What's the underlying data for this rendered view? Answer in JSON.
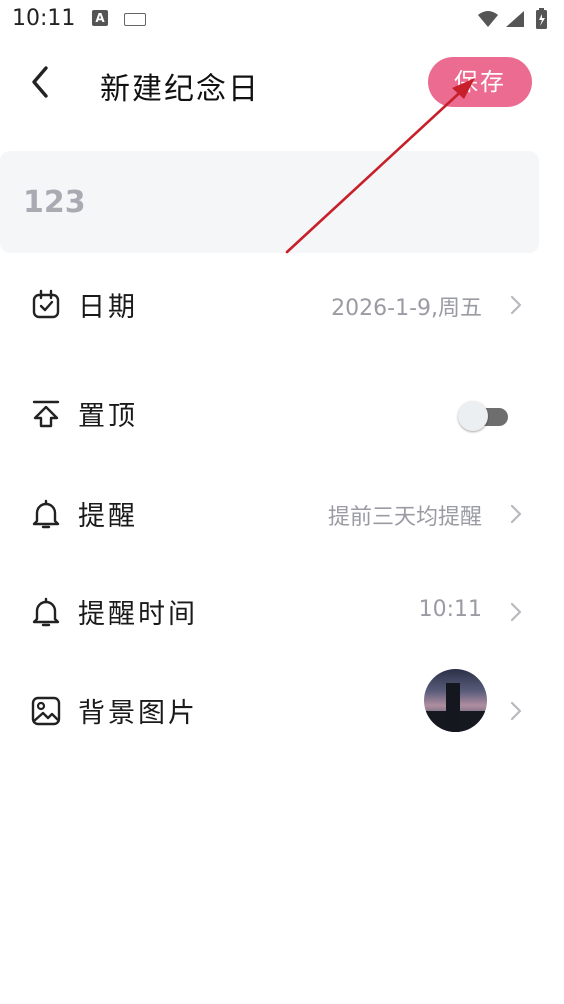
{
  "status_bar": {
    "time": "10:11",
    "a_icon_letter": "A"
  },
  "header": {
    "title": "新建纪念日",
    "save_label": "保存"
  },
  "name_input": {
    "value": "123"
  },
  "rows": [
    {
      "label": "日期",
      "value": "2026-1-9,周五",
      "icon": "calendar-check-icon"
    },
    {
      "label": "置顶",
      "toggle_on": false,
      "icon": "pin-top-icon"
    },
    {
      "label": "提醒",
      "value": "提前三天均提醒",
      "icon": "bell-icon"
    },
    {
      "label": "提醒时间",
      "value": "10:11",
      "icon": "bell-icon"
    },
    {
      "label": "背景图片",
      "icon": "image-icon"
    }
  ],
  "colors": {
    "accent": "#ec6b91",
    "annotation_arrow": "#c8202a",
    "muted_text": "#9a9ba3"
  }
}
